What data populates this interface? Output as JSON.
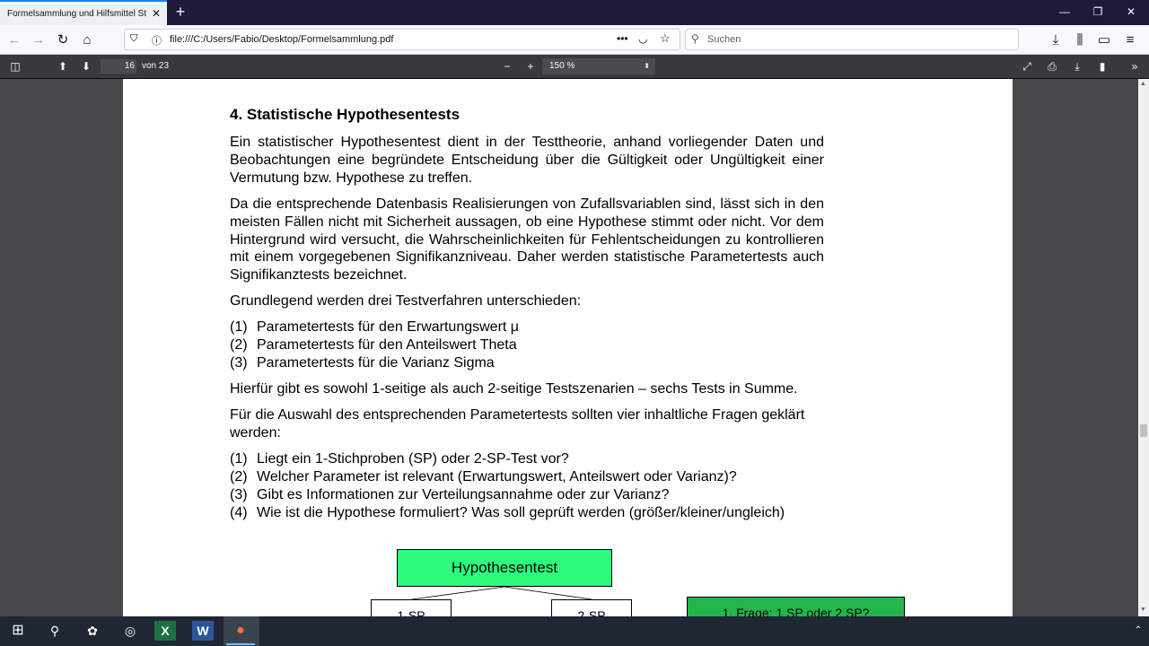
{
  "browser": {
    "tab_title": "Formelsammlung und Hilfsmittel St",
    "url": "file:///C:/Users/Fabio/Desktop/Formelsammlung.pdf",
    "search_placeholder": "Suchen"
  },
  "pdf_toolbar": {
    "page_current": "16",
    "page_total": "von 23",
    "zoom": "150 %"
  },
  "document": {
    "heading": "4. Statistische Hypothesentests",
    "para1": "Ein statistischer Hypothesentest dient in der Testtheorie, anhand vorliegender Daten und Beobachtungen eine begründete Entscheidung über die Gültigkeit oder Ungültigkeit einer Vermutung bzw. Hypothese zu treffen.",
    "para2": "Da die entsprechende Datenbasis Realisierungen von Zufallsvariablen sind, lässt sich in den meisten Fällen nicht mit Sicherheit aussagen, ob eine Hypothese stimmt oder nicht. Vor dem Hintergrund wird versucht, die Wahrscheinlichkeiten für Fehlentscheidungen zu kontrollieren mit einem vorgegebenen Signifikanzniveau. Daher werden statistische Parametertests auch Signifikanztests bezeichnet.",
    "para3": "Grundlegend werden drei Testverfahren unterschieden:",
    "list1": [
      {
        "num": "(1)",
        "text": "Parametertests für den Erwartungswert μ"
      },
      {
        "num": "(2)",
        "text": "Parametertests für den Anteilswert Theta"
      },
      {
        "num": "(3)",
        "text": "Parametertests für die Varianz Sigma"
      }
    ],
    "para4": "Hierfür gibt es sowohl 1-seitige als auch 2-seitige Testszenarien – sechs Tests in Summe.",
    "para5": "Für die Auswahl des entsprechenden Parametertests sollten vier inhaltliche Fragen geklärt werden:",
    "list2": [
      {
        "num": "(1)",
        "text": "Liegt ein 1-Stichproben (SP) oder 2-SP-Test vor?"
      },
      {
        "num": "(2)",
        "text": "Welcher Parameter ist relevant (Erwartungswert, Anteilswert oder Varianz)?"
      },
      {
        "num": "(3)",
        "text": "Gibt es Informationen zur Verteilungsannahme oder zur Varianz?"
      },
      {
        "num": "(4)",
        "text": "Wie ist die Hypothese formuliert? Was soll geprüft werden (größer/kleiner/ungleich)"
      }
    ],
    "diagram": {
      "root": "Hypothesentest",
      "left": "1-SP",
      "right": "2-SP",
      "question": "1. Frage: 1 SP oder 2 SP?"
    }
  },
  "colors": {
    "root_box": "#2dfc7e",
    "question_box": "#23b64b"
  }
}
